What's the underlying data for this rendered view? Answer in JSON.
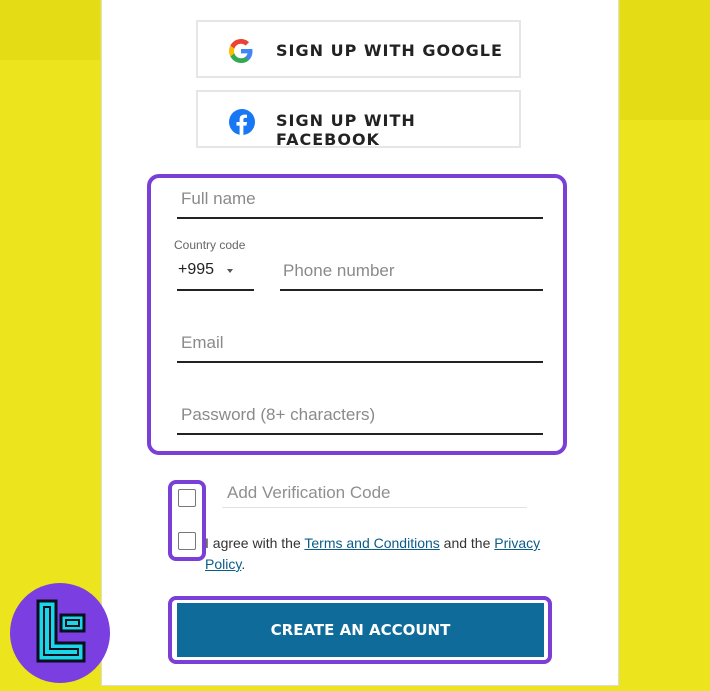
{
  "social": {
    "google_label": "SIGN UP WITH GOOGLE",
    "facebook_label": "SIGN UP WITH FACEBOOK",
    "google_icon": "google-icon",
    "facebook_icon": "facebook-icon"
  },
  "form": {
    "full_name_placeholder": "Full name",
    "country_code_label": "Country code",
    "country_code_value": "+995",
    "phone_placeholder": "Phone number",
    "email_placeholder": "Email",
    "password_placeholder": "Password (8+ characters)",
    "verification_placeholder": "Add Verification Code"
  },
  "agreement": {
    "prefix": "I agree with the ",
    "terms_link": "Terms and Conditions",
    "middle": " and the ",
    "privacy_link": "Privacy Policy",
    "suffix": "."
  },
  "submit_label": "CREATE AN ACCOUNT",
  "colors": {
    "background": "#ece41c",
    "highlight": "#7a3fd6",
    "primary_button": "#0f6b9a",
    "link": "#0c5c8a"
  }
}
